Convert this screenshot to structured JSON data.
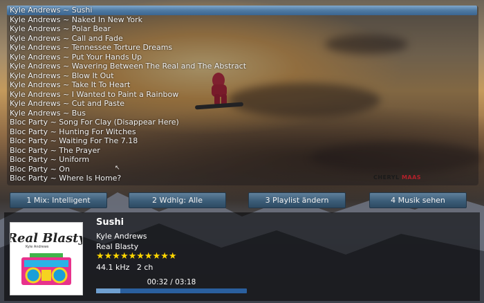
{
  "playlist": {
    "items": [
      "Kyle Andrews ~ Sushi",
      "Kyle Andrews ~ Naked In New York",
      "Kyle Andrews ~ Polar Bear",
      "Kyle Andrews ~ Call and Fade",
      "Kyle Andrews ~ Tennessee Torture Dreams",
      "Kyle Andrews ~ Put Your Hands Up",
      "Kyle Andrews ~ Wavering Between The Real and The Abstract",
      "Kyle Andrews ~ Blow It Out",
      "Kyle Andrews ~ Take It To Heart",
      "Kyle Andrews ~ I Wanted to Paint a Rainbow",
      "Kyle Andrews ~ Cut and Paste",
      "Kyle Andrews ~ Bus",
      "Bloc Party ~ Song For Clay (Disappear Here)",
      "Bloc Party ~ Hunting For Witches",
      "Bloc Party ~ Waiting For The 7.18",
      "Bloc Party ~ The Prayer",
      "Bloc Party ~ Uniform",
      "Bloc Party ~ On",
      "Bloc Party ~ Where Is Home?"
    ],
    "selected_index": 0
  },
  "watermark": {
    "first": "CHERYL",
    "last": "MAAS"
  },
  "buttons": {
    "mix": "1 Mix: Intelligent",
    "repeat": "2 Wdhlg: Alle",
    "edit_playlist": "3 Playlist ändern",
    "view_music": "4 Musik sehen"
  },
  "now_playing": {
    "title": "Sushi",
    "artist": "Kyle Andrews",
    "album": "Real Blasty",
    "rating_stars": "★★★★★★★★★★",
    "rating": 10,
    "tech_info": "44.1 kHz   2 ch",
    "time": "00:32 / 03:18",
    "progress": 0.16,
    "cover_art_text": "Real Blasty",
    "cover_art_subtext": "Kyle Andrews"
  },
  "colors": {
    "selection": "#4f7aa3",
    "button": "#3c5d78",
    "stars": "#ffd700",
    "progress": "#2a5f9e"
  }
}
